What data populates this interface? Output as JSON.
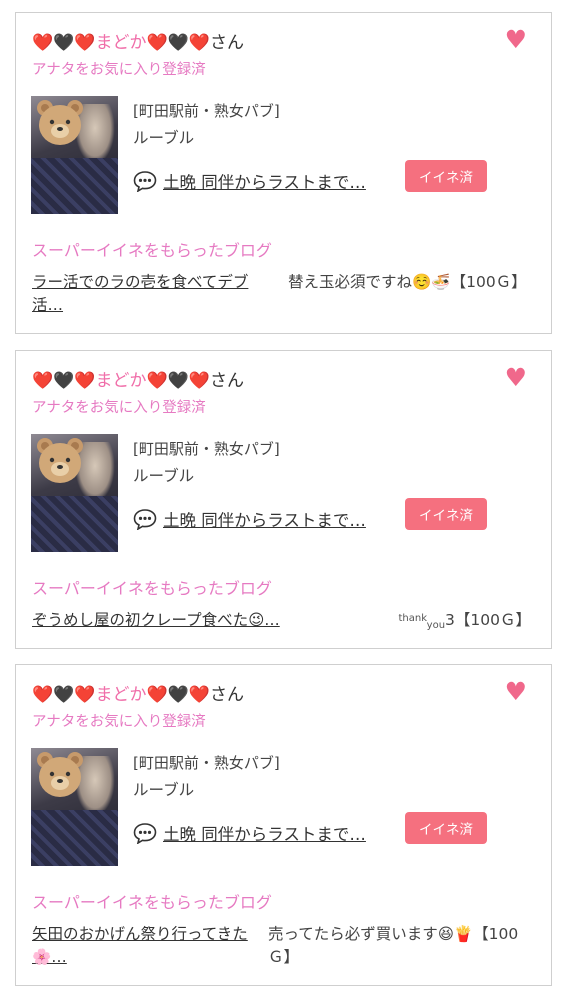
{
  "cards": [
    {
      "name_prefix": "❤️🖤❤️",
      "name_main": "まどか",
      "name_suffix": "❤️🖤❤️",
      "name_honorific": "さん",
      "fav_status": "アナタをお気に入り登録済",
      "shop_category": "[町田駅前・熟女パブ]",
      "shop_name": "ルーブル",
      "post_title": "土晩 同伴からラストまで…",
      "like_label": "イイネ済",
      "blog_heading": "スーパーイイネをもらったブログ",
      "blog_title": "ラー活でのラの壱を食べてデブ活…",
      "blog_comment": "替え玉必須ですね☺️🍜【100Ｇ】"
    },
    {
      "name_prefix": "❤️🖤❤️",
      "name_main": "まどか",
      "name_suffix": "❤️🖤❤️",
      "name_honorific": "さん",
      "fav_status": "アナタをお気に入り登録済",
      "shop_category": "[町田駅前・熟女パブ]",
      "shop_name": "ルーブル",
      "post_title": "土晩 同伴からラストまで…",
      "like_label": "イイネ済",
      "blog_heading": "スーパーイイネをもらったブログ",
      "blog_title": "ぞうめし屋の初クレープ食べた😉…",
      "blog_comment_thank": "thank",
      "blog_comment_you": "you",
      "blog_comment": "3【100Ｇ】"
    },
    {
      "name_prefix": "❤️🖤❤️",
      "name_main": "まどか",
      "name_suffix": "❤️🖤❤️",
      "name_honorific": "さん",
      "fav_status": "アナタをお気に入り登録済",
      "shop_category": "[町田駅前・熟女パブ]",
      "shop_name": "ルーブル",
      "post_title": "土晩 同伴からラストまで…",
      "like_label": "イイネ済",
      "blog_heading": "スーパーイイネをもらったブログ",
      "blog_title": "矢田のおかげん祭り行ってきた🌸…",
      "blog_comment": "売ってたら必ず買います😆🍟【100Ｇ】"
    }
  ],
  "colors": {
    "heart": "#f0688b",
    "pink_text": "#e67ac2",
    "like_button": "#f5707f"
  }
}
